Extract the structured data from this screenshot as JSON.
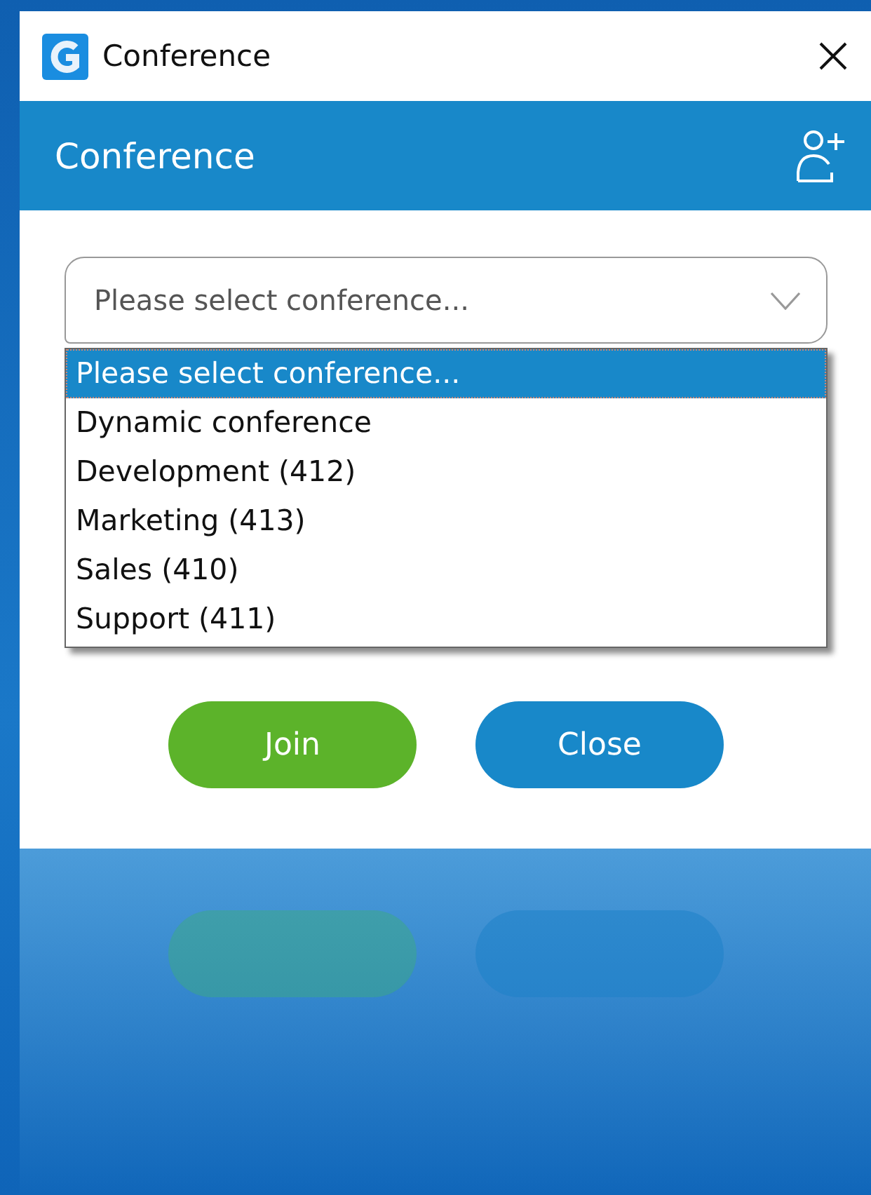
{
  "window": {
    "title": "Conference"
  },
  "header": {
    "title": "Conference"
  },
  "select": {
    "value": "Please select conference...",
    "expanded": true
  },
  "options": [
    {
      "label": "Please select conference...",
      "selected": true
    },
    {
      "label": "Dynamic conference",
      "selected": false
    },
    {
      "label": "Development (412)",
      "selected": false
    },
    {
      "label": "Marketing (413)",
      "selected": false
    },
    {
      "label": "Sales (410)",
      "selected": false
    },
    {
      "label": "Support (411)",
      "selected": false
    }
  ],
  "buttons": [
    {
      "label": "Join",
      "kind": "primary"
    },
    {
      "label": "Close",
      "kind": "secondary"
    }
  ]
}
